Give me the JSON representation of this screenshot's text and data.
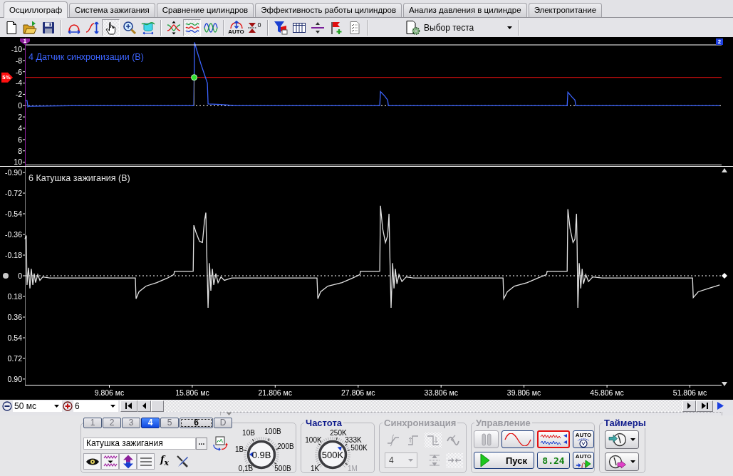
{
  "tabs": [
    {
      "label": "Осциллограф",
      "selected": true
    },
    {
      "label": "Система зажигания",
      "selected": false
    },
    {
      "label": "Сравнение цилиндров",
      "selected": false
    },
    {
      "label": "Эффективность работы цилиндров",
      "selected": false
    },
    {
      "label": "Анализ давления в цилиндре",
      "selected": false
    },
    {
      "label": "Электропитание",
      "selected": false
    }
  ],
  "toolbar": {
    "groups": [
      [
        {
          "kind": "new",
          "pressed": false
        },
        {
          "kind": "open",
          "pressed": false
        },
        {
          "kind": "save",
          "pressed": false
        }
      ],
      [
        {
          "kind": "arc-width",
          "pressed": false
        },
        {
          "kind": "curve-height",
          "pressed": false
        },
        {
          "kind": "hand",
          "pressed": true
        },
        {
          "kind": "zoom",
          "pressed": false
        },
        {
          "kind": "bracket-wave",
          "pressed": false
        }
      ],
      [
        {
          "kind": "cross-waves",
          "pressed": false
        },
        {
          "kind": "stacked-waves",
          "pressed": true
        },
        {
          "kind": "overlap-waves",
          "pressed": false
        }
      ],
      [
        {
          "kind": "auto-arc",
          "pressed": false,
          "label": "AUTO"
        },
        {
          "kind": "zero-arrows",
          "pressed": false,
          "label": "0"
        }
      ],
      [
        {
          "kind": "filter",
          "pressed": false
        },
        {
          "kind": "table",
          "pressed": false
        },
        {
          "kind": "divider",
          "pressed": false
        },
        {
          "kind": "flag-plus",
          "pressed": false
        },
        {
          "kind": "checklist",
          "pressed": false
        }
      ]
    ],
    "test_select": {
      "label": "Выбор теста"
    }
  },
  "scope": {
    "panels": [
      {
        "cursors": [
          {
            "label": "1"
          },
          {
            "label": "2"
          }
        ],
        "trigger": {
          "label": "5%"
        },
        "chart_data": {
          "type": "line",
          "title": "4 Датчик синхронизации (В)",
          "x": [
            3.7,
            3.85,
            3.91,
            3.96,
            7.05,
            15.92,
            15.97,
            16.12,
            16.43,
            16.69,
            16.84,
            16.9,
            16.95,
            17.88,
            18.39,
            18.91,
            29.37,
            29.42,
            29.73,
            29.94,
            29.99,
            42.93,
            42.98,
            43.29,
            43.49,
            43.55,
            53.96
          ],
          "series": [
            {
              "color": "#3c64ff",
              "values": [
                -0.9,
                -0.9,
                0.2,
                0.1,
                0,
                0,
                -11.2,
                -9.9,
                -7.4,
                -5.5,
                -4.4,
                -4.0,
                -0.3,
                -0.2,
                -0.1,
                0,
                0,
                -2.5,
                -1.7,
                -1.0,
                0,
                0,
                -2.4,
                -1.5,
                -1.0,
                0,
                0
              ]
            }
          ],
          "xlim": [
            3.7,
            54.1
          ],
          "ylim": [
            10.56,
            -12.02
          ],
          "yticks": [
            -10,
            -8,
            -6,
            -4,
            -2,
            0,
            2,
            4,
            6,
            8,
            10
          ],
          "ref_lines": [
            {
              "axis": "y",
              "value": -5
            }
          ]
        }
      },
      {
        "chart_data": {
          "type": "line",
          "title": "6 Катушка зажигания (В)",
          "x": [
            3.7,
            3.8,
            3.85,
            3.96,
            4.06,
            4.16,
            4.27,
            4.37,
            4.47,
            4.63,
            4.78,
            4.99,
            5.5,
            11.69,
            11.74,
            11.95,
            12.46,
            13.24,
            14.01,
            14.47,
            14.52,
            15.87,
            15.92,
            16.07,
            16.33,
            16.54,
            16.69,
            16.79,
            16.84,
            16.95,
            17.05,
            17.15,
            17.26,
            17.36,
            17.51,
            17.67,
            17.88,
            18.13,
            18.65,
            24.83,
            24.89,
            25.09,
            25.61,
            26.64,
            27.41,
            27.93,
            27.98,
            29.37,
            29.42,
            29.58,
            29.78,
            29.94,
            30.04,
            30.09,
            30.19,
            30.3,
            30.4,
            30.5,
            30.61,
            30.76,
            30.97,
            31.28,
            31.79,
            38.29,
            38.34,
            38.6,
            39.11,
            40.04,
            40.81,
            41.43,
            41.48,
            42.93,
            42.98,
            43.14,
            43.35,
            43.49,
            43.6,
            43.65,
            43.7,
            43.8,
            43.91,
            44.01,
            44.11,
            44.27,
            44.47,
            44.78,
            45.45,
            52.0,
            52.05,
            52.41,
            53.18,
            53.96
          ],
          "series": [
            {
              "color": "#e2e2e2",
              "values": [
                -0.32,
                -0.35,
                0.08,
                -0.07,
                0.11,
                -0.06,
                0.08,
                -0.02,
                0.06,
                -0.01,
                0.04,
                0.01,
                0.02,
                0.02,
                0.2,
                0.14,
                0.09,
                0.06,
                0.02,
                -0.01,
                -0.04,
                -0.04,
                -0.44,
                -0.38,
                -0.3,
                -0.29,
                -0.48,
                -0.55,
                -0.26,
                0.28,
                -0.11,
                0.13,
                -0.06,
                0.08,
                -0.02,
                0.06,
                0.01,
                0.04,
                0.02,
                0.02,
                0.2,
                0.14,
                0.09,
                0.06,
                0.02,
                -0.01,
                -0.04,
                -0.04,
                -0.61,
                -0.41,
                -0.29,
                -0.35,
                -0.54,
                -0.23,
                0.28,
                -0.11,
                0.11,
                -0.06,
                0.07,
                -0.01,
                0.05,
                0.01,
                0.02,
                0.02,
                0.2,
                0.14,
                0.09,
                0.06,
                0.02,
                -0.01,
                -0.04,
                -0.04,
                -0.58,
                -0.41,
                -0.29,
                -0.32,
                -0.54,
                -0.26,
                0.28,
                -0.11,
                0.11,
                -0.06,
                0.07,
                -0.01,
                0.05,
                0.01,
                0.02,
                0.02,
                0.19,
                0.14,
                0.11,
                0.08
              ]
            }
          ],
          "xlim": [
            3.7,
            54.1
          ],
          "ylim": [
            0.95,
            -0.95
          ],
          "xticks": [
            {
              "value": 9.806,
              "label": "9.806 мс"
            },
            {
              "value": 15.806,
              "label": "15.806 мс"
            },
            {
              "value": 21.806,
              "label": "21.806 мс"
            },
            {
              "value": 27.806,
              "label": "27.806 мс"
            },
            {
              "value": 33.806,
              "label": "33.806 мс"
            },
            {
              "value": 39.806,
              "label": "39.806 мс"
            },
            {
              "value": 45.806,
              "label": "45.806 мс"
            },
            {
              "value": 51.806,
              "label": "51.806 мс"
            }
          ],
          "yticks": [
            {
              "value": -0.9,
              "label": "-0.90"
            },
            {
              "value": -0.72,
              "label": "-0.72"
            },
            {
              "value": -0.54,
              "label": "-0.54"
            },
            {
              "value": -0.36,
              "label": "-0.36"
            },
            {
              "value": -0.18,
              "label": "-0.18"
            },
            0,
            {
              "value": 0.18,
              "label": "0.18"
            },
            {
              "value": 0.36,
              "label": "0.36"
            },
            {
              "value": 0.54,
              "label": "0.54"
            },
            {
              "value": 0.72,
              "label": "0.72"
            },
            {
              "value": 0.9,
              "label": "0.90"
            }
          ]
        }
      }
    ]
  },
  "navigation": {
    "timebase": "50 мс",
    "channel": "6"
  },
  "channel_panel": {
    "channels": [
      {
        "label": "1",
        "selected": false,
        "disabled": true,
        "focused": false
      },
      {
        "label": "2",
        "selected": false,
        "disabled": true,
        "focused": false
      },
      {
        "label": "3",
        "selected": false,
        "disabled": true,
        "focused": false
      },
      {
        "label": "4",
        "selected": true,
        "disabled": false,
        "focused": false
      },
      {
        "label": "5",
        "selected": false,
        "disabled": true,
        "focused": false
      },
      {
        "label": "6",
        "selected": false,
        "disabled": false,
        "focused": true
      },
      {
        "label": "D",
        "selected": false,
        "disabled": true,
        "focused": false
      }
    ],
    "name": "Катушка зажигания",
    "browse_label": "...",
    "tools": [
      {
        "kind": "eye"
      },
      {
        "kind": "wave"
      },
      {
        "kind": "invert"
      },
      {
        "kind": "lines"
      },
      {
        "kind": "formula",
        "label": "f$_{x}$"
      },
      {
        "kind": "tools"
      }
    ],
    "dial": {
      "scale": [
        {
          "label": "0,1В",
          "disabled": false
        },
        {
          "label": "1В",
          "disabled": false
        },
        {
          "label": "10В",
          "disabled": false
        },
        {
          "label": "100В",
          "disabled": false
        },
        {
          "label": "200В",
          "disabled": false
        },
        {
          "label": "500В",
          "disabled": false
        }
      ],
      "value": "0.9В",
      "level": 0.17
    }
  },
  "frequency": {
    "title": "Частота",
    "disabled": false,
    "dial": {
      "scale": [
        {
          "label": "1K",
          "disabled": false
        },
        {
          "label": "100K",
          "disabled": false
        },
        {
          "label": "250K",
          "disabled": false
        },
        {
          "label": "333K",
          "disabled": false
        },
        {
          "label": "500K",
          "disabled": false
        },
        {
          "label": "1M",
          "disabled": true
        }
      ],
      "value": "500K",
      "level": 0.68
    }
  },
  "sync": {
    "title": "Синхронизация",
    "disabled": true,
    "buttons": [
      {
        "kind": "slope",
        "pressed": false
      },
      {
        "kind": "step-up",
        "pressed": false
      },
      {
        "kind": "step-down",
        "pressed": true
      },
      {
        "kind": "cut-wave",
        "pressed": false
      }
    ],
    "channel": "4",
    "mode_buttons": [
      {
        "kind": "expand",
        "pressed": false
      },
      {
        "kind": "compress",
        "pressed": true
      }
    ]
  },
  "control": {
    "title": "Управление",
    "disabled": true,
    "buttons": [
      {
        "kind": "pause",
        "disabled": true,
        "active": false
      },
      {
        "kind": "sine",
        "disabled": false,
        "active": false
      },
      {
        "kind": "noise",
        "disabled": false,
        "active": true
      },
      {
        "kind": "auto-gauge",
        "disabled": false,
        "active": false,
        "label": "AUTO"
      },
      {
        "kind": "start",
        "disabled": false,
        "active": false,
        "label": "Пуск"
      },
      {
        "kind": "readout",
        "disabled": false,
        "active": false,
        "label": "8.24"
      },
      {
        "kind": "auto-arrow",
        "disabled": false,
        "active": false,
        "label": "AUTO"
      }
    ]
  },
  "timers": {
    "title": "Таймеры",
    "disabled": false,
    "buttons": [
      {
        "kind": "timer-in"
      },
      {
        "kind": "timer-out"
      }
    ]
  }
}
